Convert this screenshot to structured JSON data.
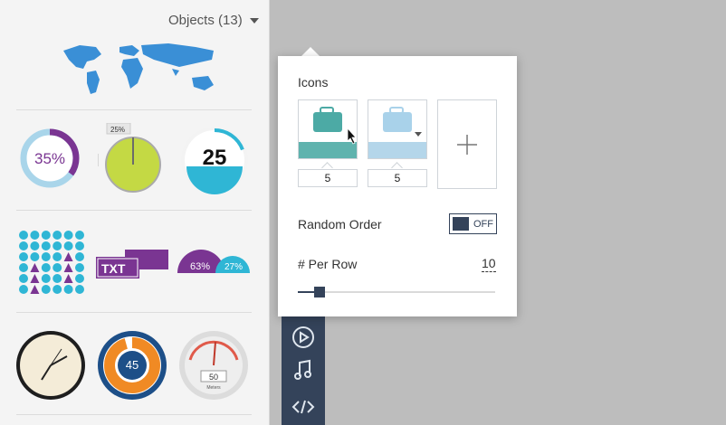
{
  "objects_panel": {
    "header_label": "Objects (13)",
    "widgets": {
      "donut_percent_label": "35%",
      "pie_percent_label": "25%",
      "ring_number_label": "25",
      "text_label": "TXT",
      "semi_left_label": "63%",
      "semi_right_label": "27%",
      "clock_gauge_label": "45",
      "speedometer_value_label": "50",
      "speedometer_unit_label": "Meters"
    }
  },
  "icons_popover": {
    "title": "Icons",
    "slots": [
      {
        "icon": "briefcase-icon",
        "value": "5",
        "color": "#4caaa5",
        "fill_color": "#5fb3ae"
      },
      {
        "icon": "briefcase-icon",
        "value": "5",
        "color": "#a9d2ea",
        "fill_color": "#b4d6ea"
      }
    ],
    "add_button_symbol": "+",
    "random_order": {
      "label": "Random Order",
      "state": "OFF"
    },
    "per_row": {
      "label": "# Per Row",
      "value": "10",
      "slider_fraction": 0.11
    }
  },
  "colors": {
    "accent_dark": "#34435a",
    "teal": "#4caaa5",
    "purple": "#7a3592",
    "cyan": "#2fb6d5",
    "orange": "#f08a24"
  }
}
